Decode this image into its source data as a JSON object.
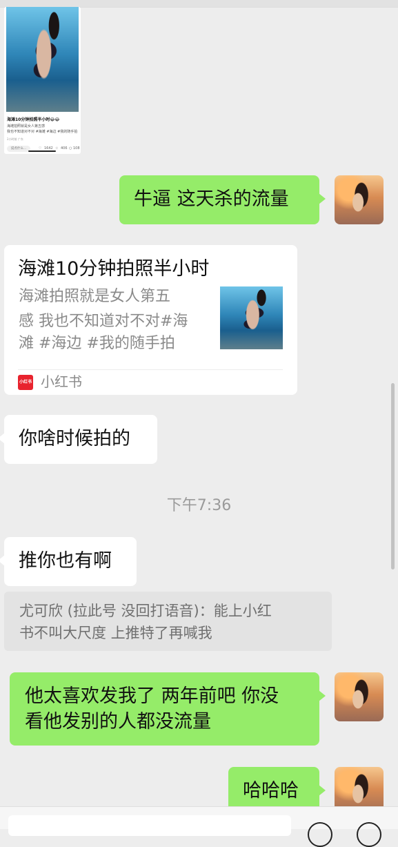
{
  "shared_post": {
    "title": "海滩10分钟拍照半小时😂😂",
    "desc_line1": "海滩拍照就是女人第五感",
    "desc_line2": "我也不知道对不对 #海滩  #海边  #我的随手拍",
    "meta": "2小时前 广东",
    "comment_placeholder": "说点什么...",
    "likes": "1642",
    "favorites": "406",
    "comments": "108"
  },
  "messages": {
    "m1": "牛逼 这天杀的流量",
    "link_card": {
      "title": "海滩10分钟拍照半小时",
      "desc_line1": "海滩拍照就是女人第五",
      "desc_line2": "感 我也不知道对不对#海",
      "desc_line3": "滩  #海边  #我的随手拍",
      "source": "小红书",
      "source_icon_text": "小红书"
    },
    "m2": "你啥时候拍的",
    "timestamp": "下午7:36",
    "m3": "推你也有啊",
    "quote_line1": "尤可欣 (拉此号 没回打语音)：能上小红",
    "quote_line2": "书不叫大尺度 上推特了再喊我",
    "m4_line1": "他太喜欢发我了 两年前吧 你没",
    "m4_line2": "看他发别的人都没流量",
    "m5": "哈哈哈"
  }
}
